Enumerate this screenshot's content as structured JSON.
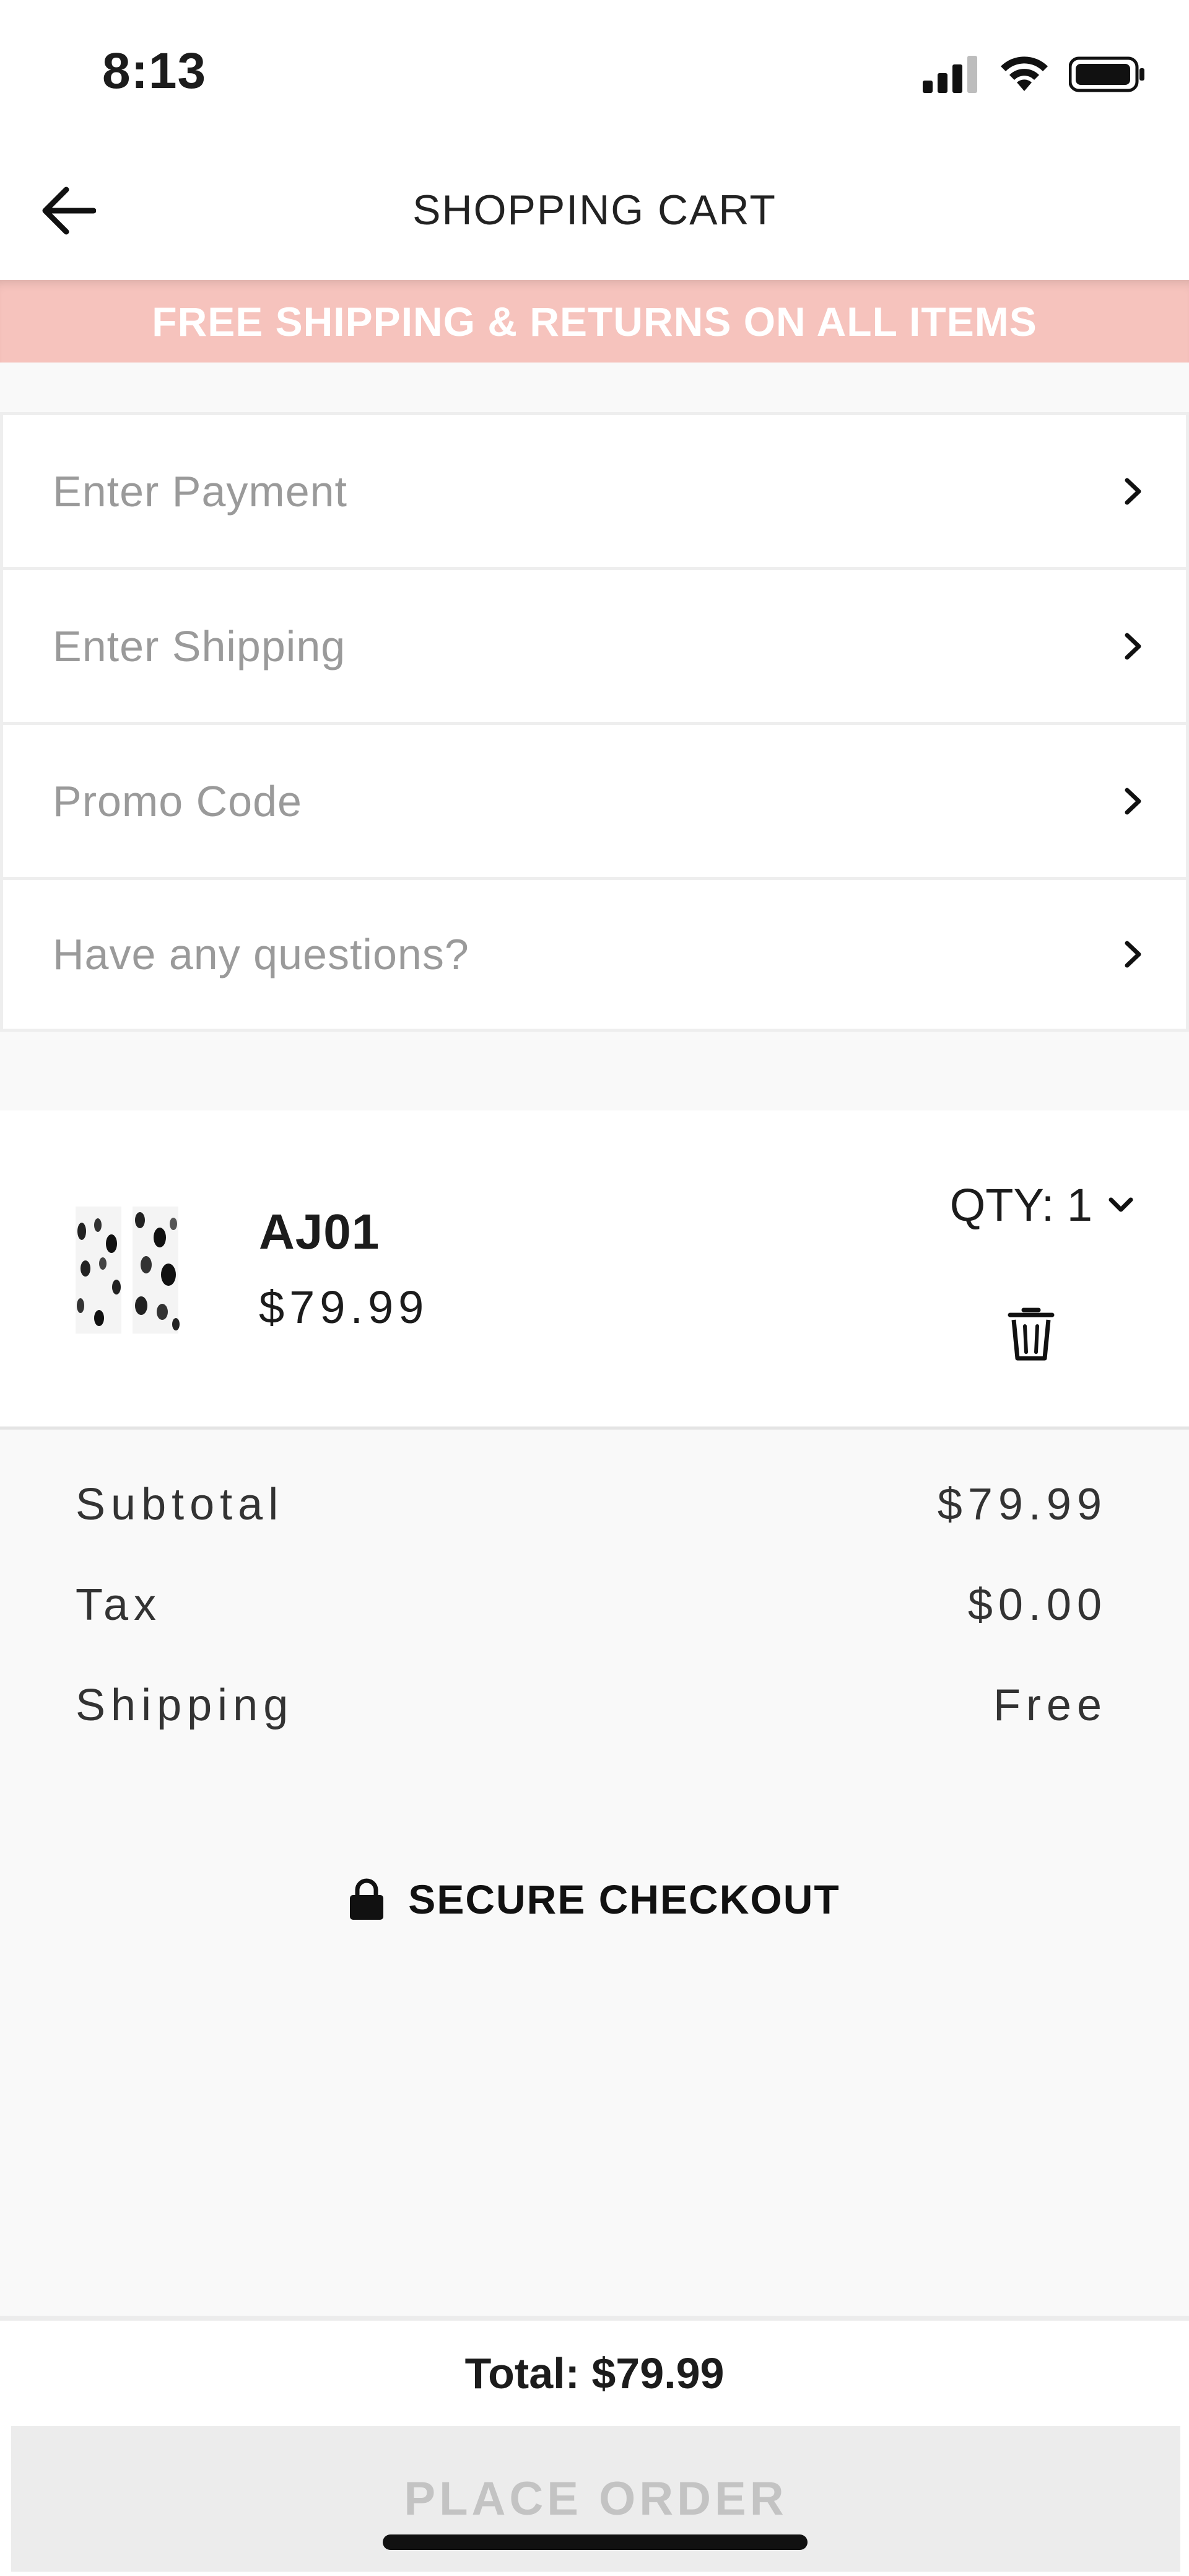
{
  "status_bar": {
    "time": "8:13"
  },
  "header": {
    "title": "SHOPPING CART"
  },
  "banner": {
    "text": "FREE SHIPPING & RETURNS ON ALL ITEMS"
  },
  "options": [
    {
      "label": "Enter Payment"
    },
    {
      "label": "Enter Shipping"
    },
    {
      "label": "Promo Code"
    },
    {
      "label": "Have any questions?"
    }
  ],
  "cart_item": {
    "name": "AJ01",
    "price": "$79.99",
    "qty_label": "QTY: 1"
  },
  "summary": {
    "subtotal_label": "Subtotal",
    "subtotal_value": "$79.99",
    "tax_label": "Tax",
    "tax_value": "$0.00",
    "shipping_label": "Shipping",
    "shipping_value": "Free",
    "secure_label": "SECURE CHECKOUT"
  },
  "footer": {
    "total": "Total: $79.99",
    "place_order": "PLACE ORDER"
  },
  "colors": {
    "banner": "#f6c3bd",
    "button_bg": "#ececec",
    "button_text": "#c3c3c3"
  }
}
